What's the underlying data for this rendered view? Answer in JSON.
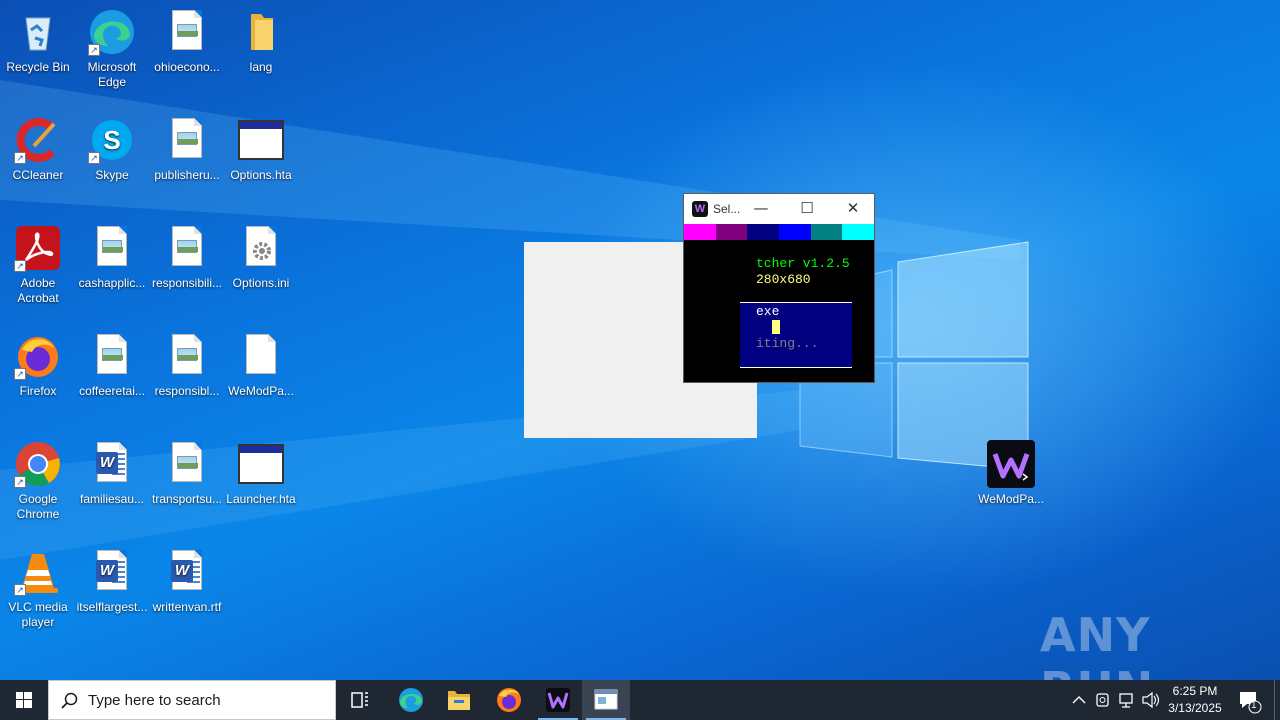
{
  "desktop": {
    "icons": [
      {
        "label": "Recycle Bin",
        "kind": "recycle-bin-icon"
      },
      {
        "label": "Microsoft Edge",
        "kind": "edge-icon"
      },
      {
        "label": "ohioecono...",
        "kind": "image-file-icon"
      },
      {
        "label": "lang",
        "kind": "folder-icon"
      },
      {
        "label": "CCleaner",
        "kind": "ccleaner-icon"
      },
      {
        "label": "Skype",
        "kind": "skype-icon"
      },
      {
        "label": "publisheru...",
        "kind": "image-file-icon"
      },
      {
        "label": "Options.hta",
        "kind": "hta-file-icon"
      },
      {
        "label": "Adobe Acrobat",
        "kind": "acrobat-icon"
      },
      {
        "label": "cashapplic...",
        "kind": "image-file-icon"
      },
      {
        "label": "responsibili...",
        "kind": "image-file-icon"
      },
      {
        "label": "Options.ini",
        "kind": "settings-file-icon"
      },
      {
        "label": "Firefox",
        "kind": "firefox-icon"
      },
      {
        "label": "coffeeretai...",
        "kind": "image-file-icon"
      },
      {
        "label": "responsibl...",
        "kind": "image-file-icon"
      },
      {
        "label": "WeModPa...",
        "kind": "blank-file-icon"
      },
      {
        "label": "Google Chrome",
        "kind": "chrome-icon"
      },
      {
        "label": "familiesau...",
        "kind": "word-file-icon"
      },
      {
        "label": "transportsu...",
        "kind": "image-file-icon"
      },
      {
        "label": "Launcher.hta",
        "kind": "hta-file-icon"
      },
      {
        "label": "VLC media player",
        "kind": "vlc-icon"
      },
      {
        "label": "itselflargest...",
        "kind": "word-file-icon"
      },
      {
        "label": "writtenvan.rtf",
        "kind": "word-file-icon"
      },
      {
        "label": "WeModPa...",
        "kind": "wemod-icon"
      }
    ],
    "watermark": "ANY RUN"
  },
  "console_window": {
    "title": "Sel...",
    "minimize": "—",
    "maximize": "☐",
    "close": "✕",
    "palette": [
      "#ff00ff",
      "#800080",
      "#000080",
      "#0000ff",
      "#008080",
      "#00ffff"
    ],
    "lines": {
      "version": "tcher v1.2.5",
      "resolution": "280x680",
      "exe": "exe",
      "status": "iting..."
    },
    "colors": {
      "green": "#00ff00",
      "yellow": "#ffff80",
      "white": "#ffffff",
      "gray": "#808080"
    }
  },
  "taskbar": {
    "search_placeholder": "Type here to search",
    "time": "6:25 PM",
    "date": "3/13/2025",
    "notification_count": "1"
  }
}
